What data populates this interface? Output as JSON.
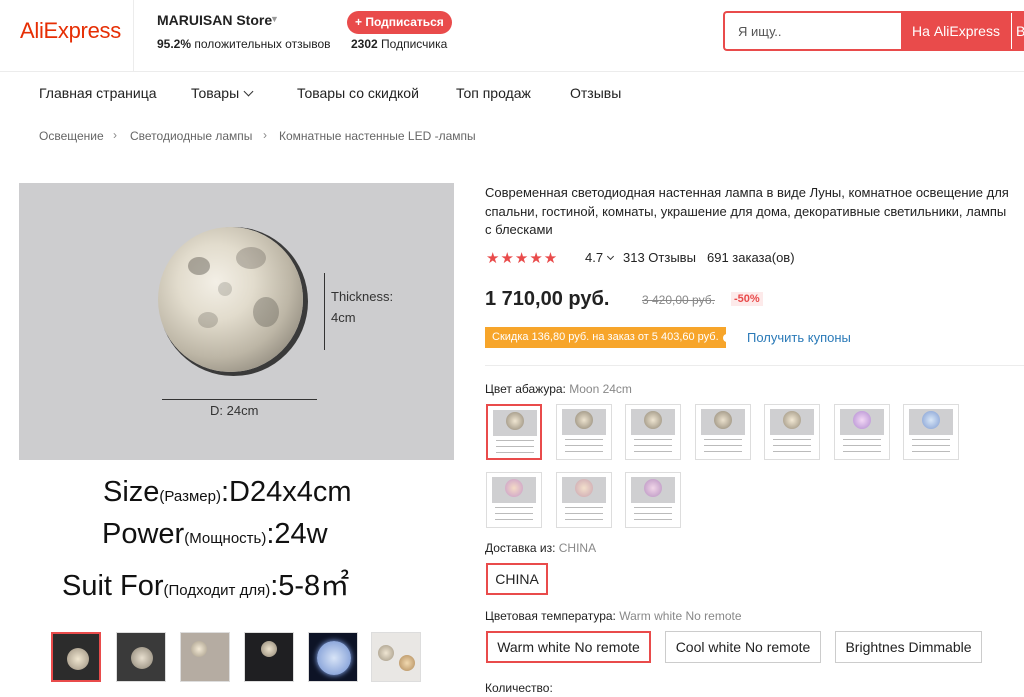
{
  "header": {
    "logo": "AliExpress",
    "store_name": "MARUISAN Store",
    "positive_pct": "95.2%",
    "positive_label": "положительных отзывов",
    "subscribe_label": "+ Подписаться",
    "subscribers_count": "2302",
    "subscribers_label": "Подписчика",
    "search_placeholder": "Я ищу..",
    "search_button": "На AliExpress",
    "search_button2": "В"
  },
  "nav": {
    "items": [
      "Главная страница",
      "Товары",
      "Товары со скидкой",
      "Топ продаж",
      "Отзывы"
    ]
  },
  "breadcrumb": [
    "Освещение",
    "Светодиодные лампы",
    "Комнатные настенные LED -лампы"
  ],
  "image": {
    "thickness_label": "Thickness:",
    "thickness_value": "4cm",
    "diameter_label": "D: 24cm",
    "spec1_big": "Size",
    "spec1_small": "(Размер)",
    "spec1_value": ":D24x4cm",
    "spec2_big": "Power",
    "spec2_small": "(Мощность)",
    "spec2_value": ":24w",
    "spec3_big": "Suit For",
    "spec3_small": "(Подходит для)",
    "spec3_value": ":5-8㎡"
  },
  "product": {
    "title": "Современная светодиодная настенная лампа в виде Луны, комнатное освещение для спальни, гостиной, комнаты, украшение для дома, декоративные светильники, лампы с блесками",
    "stars": "★★★★★",
    "rating": "4.7",
    "rating_fraction": 0.94,
    "reviews": "313 Отзывы",
    "orders": "691 заказа(ов)",
    "price": "1 710,00 руб.",
    "old_price": "3 420,00 руб.",
    "discount": "-50%",
    "coupon_text": "Скидка 136,80 руб. на заказ от 5 403,60 руб.",
    "coupon_link": "Получить купоны"
  },
  "options": {
    "shade_label": "Цвет абажура:",
    "shade_value": "Moon 24cm",
    "shipping_label": "Доставка из:",
    "shipping_value": "CHINA",
    "shipping_option": "CHINA",
    "temp_label": "Цветовая температура:",
    "temp_value": "Warm white No remote",
    "temp_options": [
      "Warm white No remote",
      "Cool white No remote",
      "Brightnes Dimmable"
    ],
    "qty_label": "Количество:"
  },
  "colors": {
    "accent": "#e94b4b",
    "brand": "#e62e04",
    "coupon": "#f7a52a",
    "link": "#2a7ab8"
  }
}
